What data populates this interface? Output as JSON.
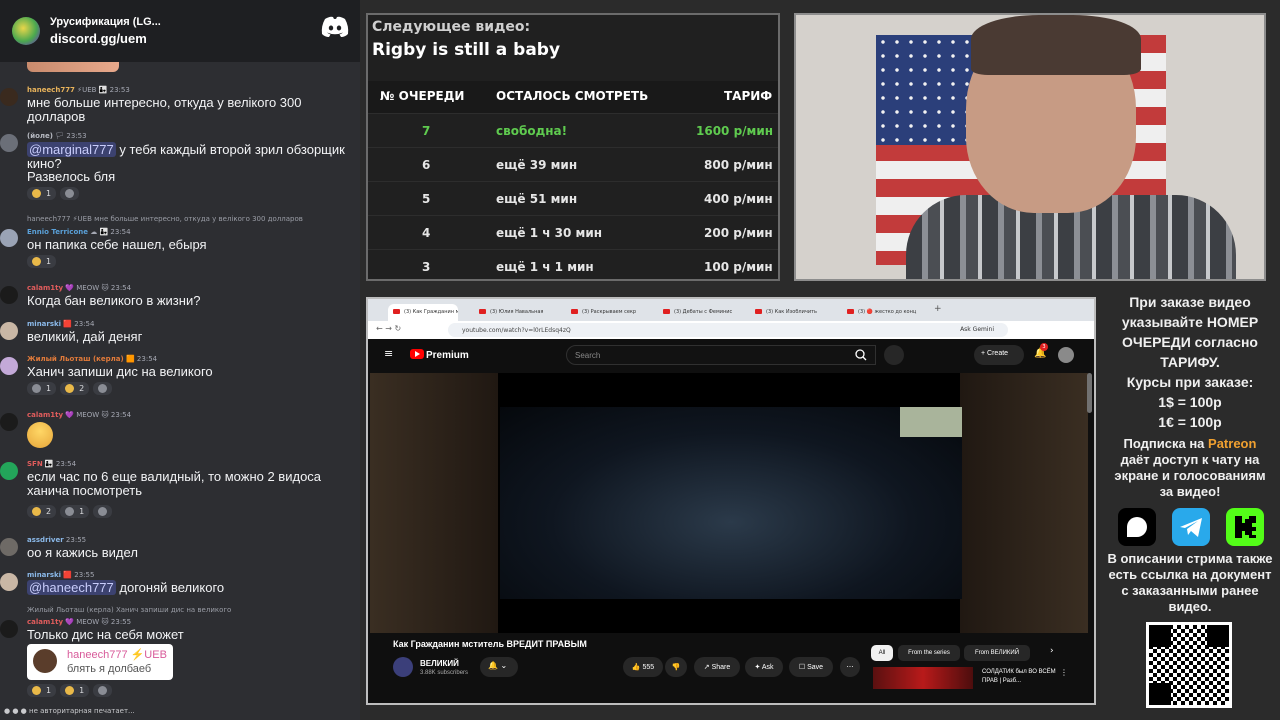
{
  "server": {
    "name": "Урусификация (LG...",
    "link": "discord.gg/uem"
  },
  "chat": {
    "messages": [
      {
        "user": "haneech777",
        "badges": "⚡UEB 👨‍👧",
        "time": "23:53",
        "text": "мне больше интересно, откуда у велікого 300 долларов",
        "color": "#e8b35b"
      },
      {
        "user": "(йоле)",
        "badges": "🏳",
        "time": "23:53",
        "mention": "@marginal777",
        "text": " у тебя каждый второй зрил обзорщик кино?",
        "text2": "Развелось бля",
        "reacts": [
          "1",
          ""
        ],
        "color": "#b7bac2"
      },
      {
        "reply": "haneech777 ⚡UEB мне больше интересно, откуда у велікого 300 долларов",
        "user": "Ennio Terricone",
        "badges": "☁ 👨‍👧",
        "time": "23:54",
        "text": "он папика себе нашел, ебыря",
        "reacts": [
          "1"
        ],
        "color": "#5aa0d8"
      },
      {
        "user": "calam1ty",
        "badges": "💜 MEOW 🐱",
        "time": "23:54",
        "text": "Когда бан великого в жизни?",
        "color": "#e05c5c"
      },
      {
        "user": "minarski",
        "badges": "🟥",
        "time": "23:54",
        "text": "великий, дай деняг",
        "color": "#8ab8e8"
      },
      {
        "user": "Жилый Льоташ (керла)",
        "badges": "🟧",
        "time": "23:54",
        "text": "Ханич запиши дис на великого",
        "reacts": [
          "1",
          "2",
          ""
        ],
        "color": "#e07a3a"
      },
      {
        "user": "calam1ty",
        "badges": "💜 MEOW 🐱",
        "time": "23:54",
        "color": "#e05c5c"
      },
      {
        "user": "SFN",
        "badges": "👨‍👧",
        "time": "23:54",
        "text": "если час по 6 еще валидный, то можно 2 видоса ханича посмотреть",
        "reacts": [
          "2",
          "1",
          ""
        ],
        "color": "#e05c5c"
      },
      {
        "user": "assdriver",
        "badges": "",
        "time": "23:55",
        "text": "оо я кажись видел",
        "color": "#d8d8d8"
      },
      {
        "user": "minarski",
        "badges": "🟥",
        "time": "23:55",
        "mention": "@haneech777",
        "text": " догоняй великого",
        "color": "#8ab8e8"
      },
      {
        "reply": "Жилый Льоташ (керла) Ханич запиши дис на великого",
        "user": "calam1ty",
        "badges": "💜 MEOW 🐱",
        "time": "23:55",
        "text": "Только дис на себя может",
        "reacts": [
          "1",
          "1",
          ""
        ],
        "color": "#e05c5c"
      }
    ],
    "embed": {
      "user": "haneech777 ⚡UEB",
      "text": "блять я долбаеб"
    },
    "typing": "не авторитарная печатает..."
  },
  "queue": {
    "next_label": "Следующее видео:",
    "next_title": "Rigby is still a baby",
    "headers": [
      "№ ОЧЕРЕДИ",
      "ОСТАЛОСЬ СМОТРЕТЬ",
      "ТАРИФ"
    ],
    "rows": [
      {
        "n": "7",
        "left": "свободна!",
        "price": "1600 р/мин",
        "free": true
      },
      {
        "n": "6",
        "left": "ещё 39 мин",
        "price": "800 р/мин"
      },
      {
        "n": "5",
        "left": "ещё 51 мин",
        "price": "400 р/мин"
      },
      {
        "n": "4",
        "left": "ещё 1 ч 30 мин",
        "price": "200 р/мин"
      },
      {
        "n": "3",
        "left": "ещё 1 ч 1 мин",
        "price": "100 р/мин"
      }
    ]
  },
  "browser": {
    "tabs": [
      "(3) Как Гражданин мст",
      "(3) Юлия Навальная",
      "(3) Раскрываем секр",
      "(3) Дебаты с Феминис",
      "(3) Как Изобличить",
      "(3) 🔴 жестко до конц"
    ],
    "url": "youtube.com/watch?v=l0rLEdsq4zQ",
    "ask_gemini": "Ask Gemini"
  },
  "youtube": {
    "brand": "Premium",
    "search_placeholder": "Search",
    "create": "Create",
    "bell_count": "3",
    "title": "Как Гражданин мститель ВРЕДИТ ПРАВЫМ",
    "channel": "ВЕЛИКИЙ",
    "subs": "3.88K subscribers",
    "likes": "555",
    "share": "Share",
    "ask": "Ask",
    "save": "Save",
    "chips": [
      "All",
      "From the series",
      "From ВЕЛИКИЙ"
    ],
    "related": "СОЛДАТИК был ВО ВСЁМ ПРАВ | Разб..."
  },
  "info": {
    "order_lines": [
      "При заказе видео",
      "указывайте НОМЕР",
      "ОЧЕРЕДИ согласно",
      "ТАРИФУ."
    ],
    "rates": [
      "Курсы при заказе:",
      "1$ = 100р",
      "1€ = 100р"
    ],
    "sub_pre": "Подписка на ",
    "sub_brand": "Patreon",
    "sub_lines": [
      "даёт доступ к чату на",
      "экране и голосованиям",
      "за видео!"
    ],
    "desc_lines": [
      "В описании стрима также",
      "есть ссылка на документ",
      "с заказанными ранее",
      "видео."
    ]
  },
  "colors": {
    "free": "#5fcb4f",
    "patreon": "#f0a030",
    "telegram": "#29a9eb",
    "kick": "#53fc18"
  }
}
